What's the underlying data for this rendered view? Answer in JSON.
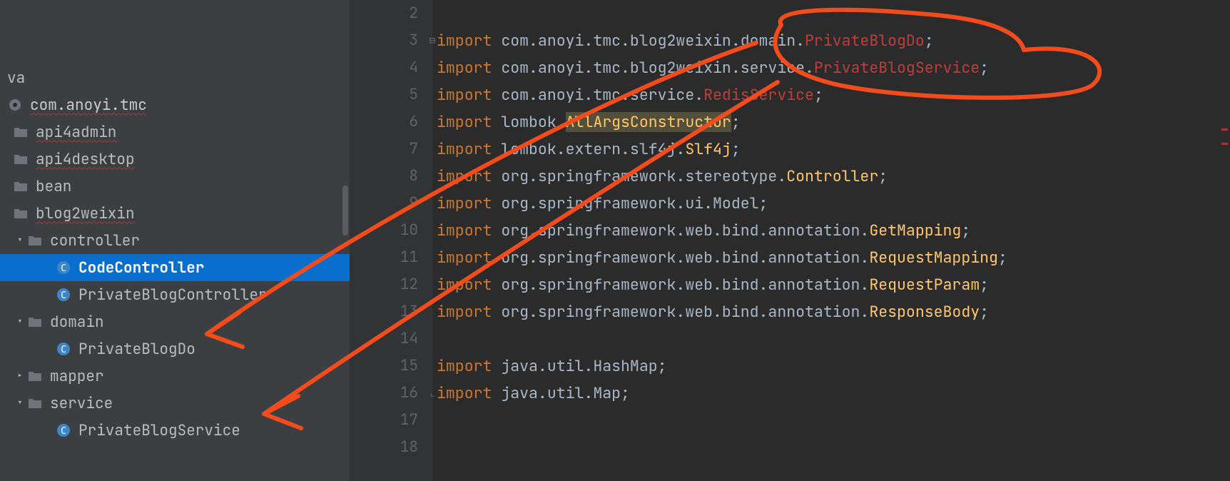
{
  "sidebar": {
    "root_file": "va",
    "pkg_root": "com.anoyi.tmc",
    "items": [
      {
        "label": "api4admin",
        "type": "folder",
        "underline": true
      },
      {
        "label": "api4desktop",
        "type": "folder",
        "underline": true
      },
      {
        "label": "bean",
        "type": "folder",
        "underline": false
      },
      {
        "label": "blog2weixin",
        "type": "folder",
        "underline": true
      }
    ],
    "controller": {
      "label": "controller",
      "children": [
        {
          "label": "CodeController",
          "selected": true
        },
        {
          "label": "PrivateBlogController",
          "selected": false
        }
      ]
    },
    "domain": {
      "label": "domain",
      "children": [
        {
          "label": "PrivateBlogDo"
        }
      ]
    },
    "mapper": {
      "label": "mapper"
    },
    "service": {
      "label": "service",
      "children": [
        {
          "label": "PrivateBlogService"
        }
      ]
    }
  },
  "code": {
    "lines": [
      {
        "n": "2",
        "tokens": [
          {
            "t": "",
            "c": "txt"
          }
        ]
      },
      {
        "n": "3",
        "fold": "start",
        "tokens": [
          {
            "t": "import ",
            "c": "kw"
          },
          {
            "t": "com.anoyi.tmc.blog2weixin.domain.",
            "c": "txt"
          },
          {
            "t": "PrivateBlogDo",
            "c": "err"
          },
          {
            "t": ";",
            "c": "txt"
          }
        ]
      },
      {
        "n": "4",
        "tokens": [
          {
            "t": "import ",
            "c": "kw"
          },
          {
            "t": "com.anoyi.tmc.blog2weixin.service.",
            "c": "txt"
          },
          {
            "t": "PrivateBlogService",
            "c": "err"
          },
          {
            "t": ";",
            "c": "txt"
          }
        ]
      },
      {
        "n": "5",
        "tokens": [
          {
            "t": "import ",
            "c": "kw"
          },
          {
            "t": "com.anoyi.tmc.service.",
            "c": "txt"
          },
          {
            "t": "RedisService",
            "c": "err"
          },
          {
            "t": ";",
            "c": "txt"
          }
        ]
      },
      {
        "n": "6",
        "tokens": [
          {
            "t": "import ",
            "c": "kw"
          },
          {
            "t": "lombok.",
            "c": "txt"
          },
          {
            "t": "AllArgsConstructor",
            "c": "cls anno-bg"
          },
          {
            "t": ";",
            "c": "txt"
          }
        ]
      },
      {
        "n": "7",
        "tokens": [
          {
            "t": "import ",
            "c": "kw"
          },
          {
            "t": "lombok.extern.slf4j.",
            "c": "txt"
          },
          {
            "t": "Slf4j",
            "c": "cls"
          },
          {
            "t": ";",
            "c": "txt"
          }
        ]
      },
      {
        "n": "8",
        "tokens": [
          {
            "t": "import ",
            "c": "kw"
          },
          {
            "t": "org.springframework.stereotype.",
            "c": "txt"
          },
          {
            "t": "Controller",
            "c": "cls"
          },
          {
            "t": ";",
            "c": "txt"
          }
        ]
      },
      {
        "n": "9",
        "tokens": [
          {
            "t": "import ",
            "c": "kw"
          },
          {
            "t": "org.springframework.ui.Model;",
            "c": "txt"
          }
        ]
      },
      {
        "n": "10",
        "tokens": [
          {
            "t": "import ",
            "c": "kw"
          },
          {
            "t": "org.springframework.web.bind.annotation.",
            "c": "txt"
          },
          {
            "t": "GetMapping",
            "c": "cls"
          },
          {
            "t": ";",
            "c": "txt"
          }
        ]
      },
      {
        "n": "11",
        "tokens": [
          {
            "t": "import ",
            "c": "kw"
          },
          {
            "t": "org.springframework.web.bind.annotation.",
            "c": "txt"
          },
          {
            "t": "RequestMapping",
            "c": "cls"
          },
          {
            "t": ";",
            "c": "txt"
          }
        ]
      },
      {
        "n": "12",
        "tokens": [
          {
            "t": "import ",
            "c": "kw"
          },
          {
            "t": "org.springframework.web.bind.annotation.",
            "c": "txt"
          },
          {
            "t": "RequestParam",
            "c": "cls"
          },
          {
            "t": ";",
            "c": "txt"
          }
        ]
      },
      {
        "n": "13",
        "tokens": [
          {
            "t": "import ",
            "c": "kw"
          },
          {
            "t": "org.springframework.web.bind.annotation.",
            "c": "txt"
          },
          {
            "t": "ResponseBody",
            "c": "cls"
          },
          {
            "t": ";",
            "c": "txt"
          }
        ]
      },
      {
        "n": "14",
        "tokens": [
          {
            "t": "",
            "c": "txt"
          }
        ]
      },
      {
        "n": "15",
        "tokens": [
          {
            "t": "import ",
            "c": "kw"
          },
          {
            "t": "java.util.HashMap;",
            "c": "txt"
          }
        ]
      },
      {
        "n": "16",
        "fold": "end",
        "tokens": [
          {
            "t": "import ",
            "c": "kw"
          },
          {
            "t": "java.util.Map;",
            "c": "txt"
          }
        ]
      },
      {
        "n": "17",
        "tokens": [
          {
            "t": "",
            "c": "txt"
          }
        ]
      },
      {
        "n": "18",
        "tokens": [
          {
            "t": "",
            "c": "txt"
          }
        ]
      }
    ]
  },
  "colors": {
    "keyword": "#CC7832",
    "text": "#A9B7C6",
    "class": "#FFC66D",
    "error": "#BC3F3C",
    "selection": "#0A6ECC",
    "markup": "#F24C1D"
  }
}
